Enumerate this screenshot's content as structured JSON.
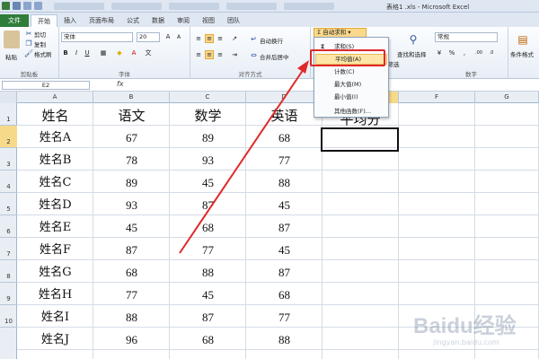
{
  "window": {
    "title": "表格1 .xls - Microsoft Excel"
  },
  "tabs": [
    "文件",
    "开始",
    "插入",
    "页面布局",
    "公式",
    "数据",
    "审阅",
    "视图",
    "团队"
  ],
  "ribbon": {
    "clipboard": {
      "paste": "粘贴",
      "cut": "剪切",
      "copy": "复制",
      "format_painter": "格式刷",
      "label": "剪贴板"
    },
    "font": {
      "name": "宋体",
      "size": "20",
      "label": "字体"
    },
    "alignment": {
      "wrap": "自动换行",
      "merge": "合并后居中",
      "label": "对齐方式"
    },
    "editing": {
      "autosum": "自动求和",
      "sort_filter": "排序和筛选",
      "find_select": "查找和选择"
    },
    "number": {
      "format": "常规",
      "label": "数字"
    },
    "styles": {
      "cond_format": "条件格式"
    }
  },
  "menu": {
    "items": [
      "求和(S)",
      "平均值(A)",
      "计数(C)",
      "最大值(M)",
      "最小值(I)",
      "其他函数(F)..."
    ]
  },
  "formula_bar": {
    "name_box": "E2",
    "fx": "fx"
  },
  "columns": [
    "A",
    "B",
    "C",
    "D",
    "E",
    "F",
    "G"
  ],
  "rows": [
    "1",
    "2",
    "3",
    "4",
    "5",
    "6",
    "7",
    "8",
    "9",
    "10"
  ],
  "sheet": {
    "headers": [
      "姓名",
      "语文",
      "数学",
      "英语",
      "平均分"
    ],
    "data": [
      [
        "姓名A",
        "67",
        "89",
        "68"
      ],
      [
        "姓名B",
        "78",
        "93",
        "77"
      ],
      [
        "姓名C",
        "89",
        "45",
        "88"
      ],
      [
        "姓名D",
        "93",
        "87",
        "45"
      ],
      [
        "姓名E",
        "45",
        "68",
        "87"
      ],
      [
        "姓名F",
        "87",
        "77",
        "45"
      ],
      [
        "姓名G",
        "68",
        "88",
        "87"
      ],
      [
        "姓名H",
        "77",
        "45",
        "68"
      ],
      [
        "姓名I",
        "88",
        "87",
        "77"
      ],
      [
        "姓名J",
        "96",
        "68",
        "88"
      ]
    ]
  },
  "watermark": {
    "brand": "Baidu经验",
    "url": "jingyan.baidu.com"
  },
  "colors": {
    "file_tab": "#2f7d3b",
    "highlight": "#e0282a",
    "arrow": "#e0282a"
  }
}
